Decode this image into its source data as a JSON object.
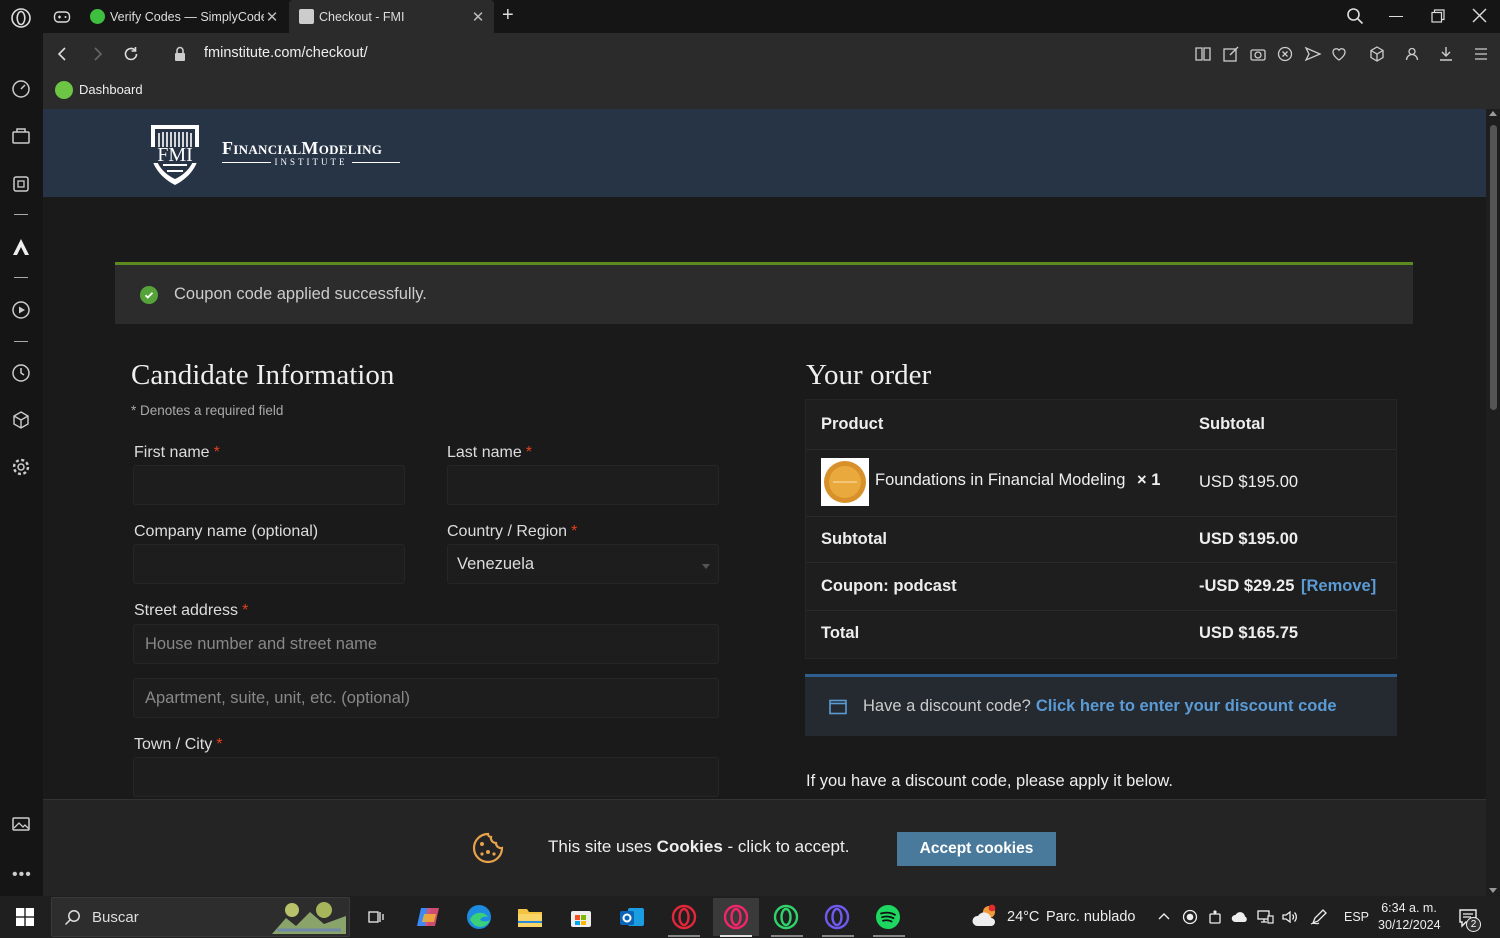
{
  "browser": {
    "tabs": [
      {
        "title": "Verify Codes — SimplyCodes",
        "active": false
      },
      {
        "title": "Checkout - FMI",
        "active": true
      }
    ],
    "new_tab": "+",
    "address": "fminstitute.com/checkout/",
    "bookmark": "Dashboard"
  },
  "site": {
    "logo_mark": "FMI",
    "logo_name": "FinancialModeling",
    "logo_sub": "INSTITUTE"
  },
  "notice": {
    "text": "Coupon code applied successfully."
  },
  "candidate": {
    "heading": "Candidate Information",
    "required_note": "* Denotes a required field",
    "required_mark": "*",
    "first_name": "First name",
    "last_name": "Last name",
    "company": "Company name (optional)",
    "country_label": "Country / Region",
    "country_value": "Venezuela",
    "street": "Street address",
    "street_placeholder": "House number and street name",
    "street2_placeholder": "Apartment, suite, unit, etc. (optional)",
    "city": "Town / City"
  },
  "order": {
    "heading": "Your order",
    "col_product": "Product",
    "col_subtotal": "Subtotal",
    "item_name": "Foundations in Financial Modeling",
    "item_qty": "× 1",
    "item_price": "USD $195.00",
    "subtotal_label": "Subtotal",
    "subtotal_value": "USD $195.00",
    "coupon_label": "Coupon: podcast",
    "coupon_value": "-USD $29.25",
    "coupon_remove": "[Remove]",
    "total_label": "Total",
    "total_value": "USD $165.75"
  },
  "discount": {
    "prompt": "Have a discount code?",
    "link": "Click here to enter your discount code",
    "note": "If you have a discount code, please apply it below."
  },
  "cookies": {
    "text_a": "This site uses",
    "text_b": "Cookies",
    "text_c": "- click to accept.",
    "button": "Accept cookies"
  },
  "taskbar": {
    "search": "Buscar",
    "weather_temp": "24°C",
    "weather_desc": "Parc. nublado",
    "lang": "ESP",
    "time": "6:34 a. m.",
    "date": "30/12/2024",
    "notif_count": "2"
  },
  "colors": {
    "accent_link": "#5b9bd5",
    "success": "#56a33a",
    "required": "#e2401c",
    "header": "#263446",
    "cookie_button": "#4a7a9b"
  }
}
